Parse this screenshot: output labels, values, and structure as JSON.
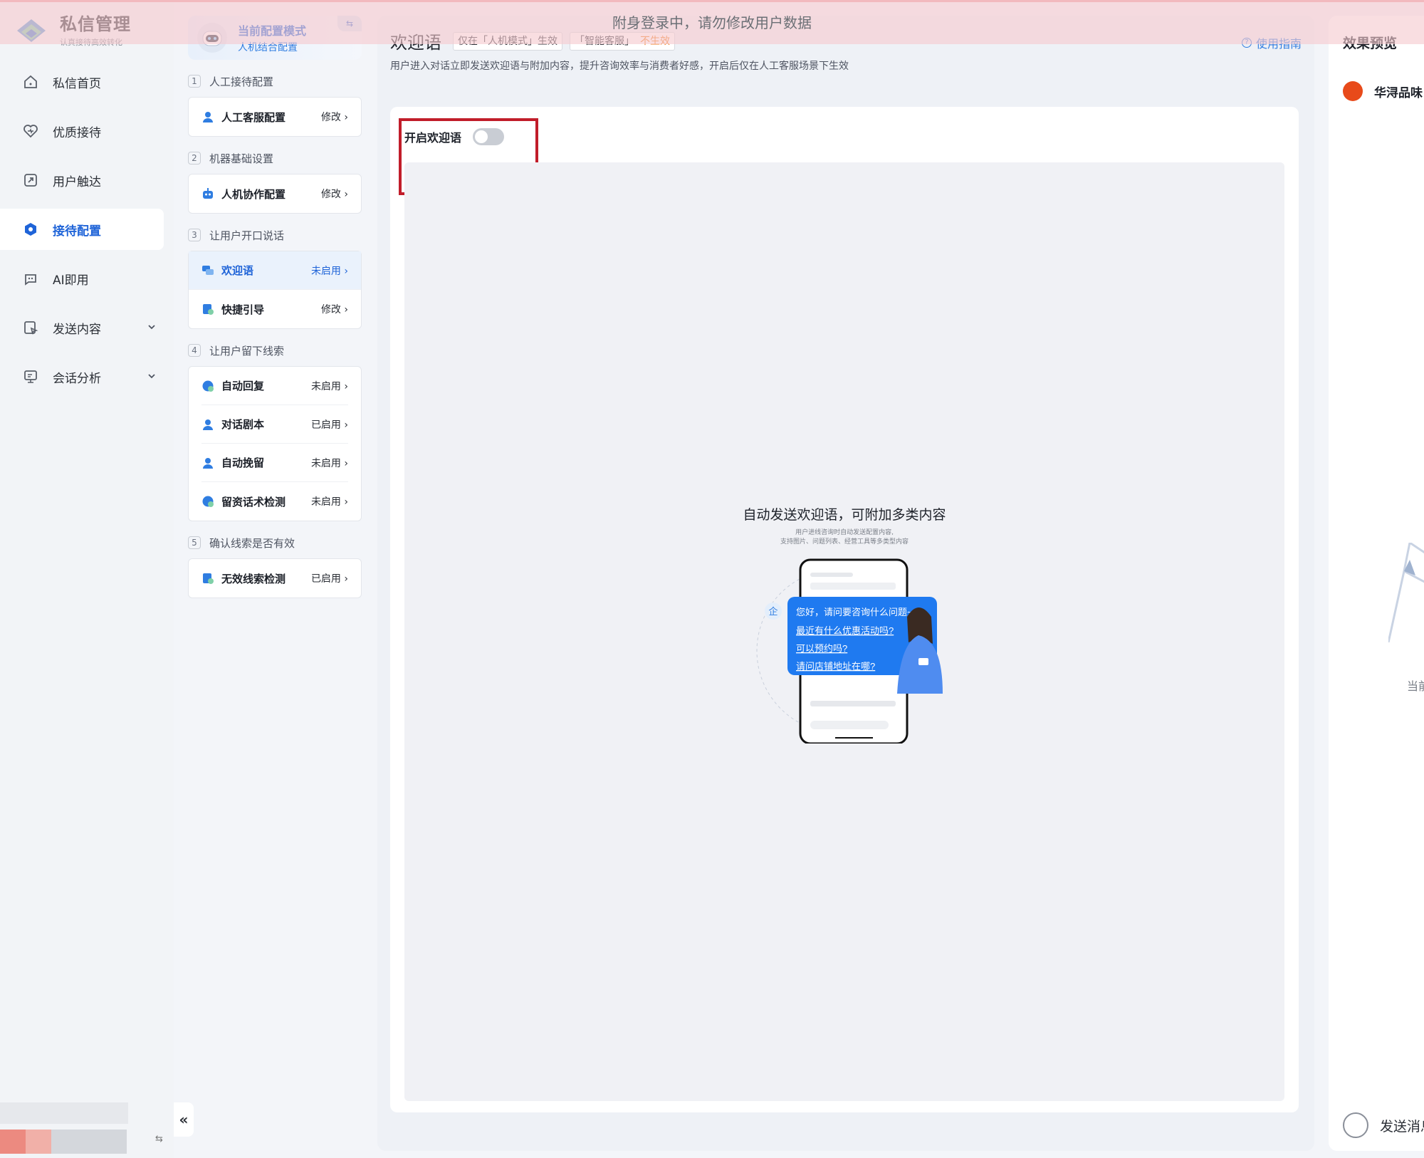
{
  "banner": {
    "text": "附身登录中，请勿修改用户数据"
  },
  "app": {
    "title": "私信管理",
    "subtitle": "认真接待高效转化"
  },
  "nav": {
    "items": [
      {
        "label": "私信首页",
        "icon": "home-icon"
      },
      {
        "label": "优质接待",
        "icon": "heart-icon"
      },
      {
        "label": "用户触达",
        "icon": "send-icon"
      },
      {
        "label": "接待配置",
        "icon": "config-icon",
        "active": true
      },
      {
        "label": "AI即用",
        "icon": "ai-icon"
      },
      {
        "label": "发送内容",
        "icon": "content-icon",
        "expandable": true
      },
      {
        "label": "会话分析",
        "icon": "analysis-icon",
        "expandable": true
      }
    ],
    "collapse_label": "«",
    "switch_label": "⇆"
  },
  "config": {
    "mode_title": "当前配置模式",
    "mode_value": "人机结合配置",
    "swap_label": "⇆",
    "sections": [
      {
        "num": "1",
        "title": "人工接待配置",
        "items": [
          {
            "label": "人工客服配置",
            "status": "修改 ›"
          }
        ]
      },
      {
        "num": "2",
        "title": "机器基础设置",
        "items": [
          {
            "label": "人机协作配置",
            "status": "修改 ›"
          }
        ]
      },
      {
        "num": "3",
        "title": "让用户开口说话",
        "items": [
          {
            "label": "欢迎语",
            "status": "未启用 ›",
            "selected": true
          },
          {
            "label": "快捷引导",
            "status": "修改 ›"
          }
        ]
      },
      {
        "num": "4",
        "title": "让用户留下线索",
        "items": [
          {
            "label": "自动回复",
            "status": "未启用 ›"
          },
          {
            "label": "对话剧本",
            "status": "已启用 ›"
          },
          {
            "label": "自动挽留",
            "status": "未启用 ›"
          },
          {
            "label": "留资话术检测",
            "status": "未启用 ›"
          }
        ]
      },
      {
        "num": "5",
        "title": "确认线索是否有效",
        "items": [
          {
            "label": "无效线索检测",
            "status": "已启用 ›"
          }
        ]
      }
    ]
  },
  "main": {
    "title": "欢迎语",
    "tag1": "仅在「人机模式」生效",
    "tag2": "「智能客服」",
    "tag2_warn": "不生效",
    "description": "用户进入对话立即发送欢迎语与附加内容，提升咨询效率与消费者好感，开启后仅在人工客服场景下生效",
    "guide_label": "使用指南",
    "toggle_label": "开启欢迎语",
    "toggle_on": false,
    "empty_title": "自动发送欢迎语，可附加多类内容",
    "empty_sub1": "用户进线咨询时自动发送配置内容,",
    "empty_sub2": "支持图片、问题列表、经营工具等多类型内容",
    "bubble_lines": [
      "您好，请问要咨询什么问题~",
      "最近有什么优惠活动吗?",
      "可以预约吗?",
      "请问店铺地址在哪?"
    ],
    "badge": "企"
  },
  "preview": {
    "title": "效果预览",
    "shop_name": "华浔品味",
    "note": "当前",
    "send_label": "发送消息"
  },
  "colors": {
    "accent": "#1f64d8",
    "highlight": "#c11d2a",
    "warn": "#f07c1c"
  }
}
